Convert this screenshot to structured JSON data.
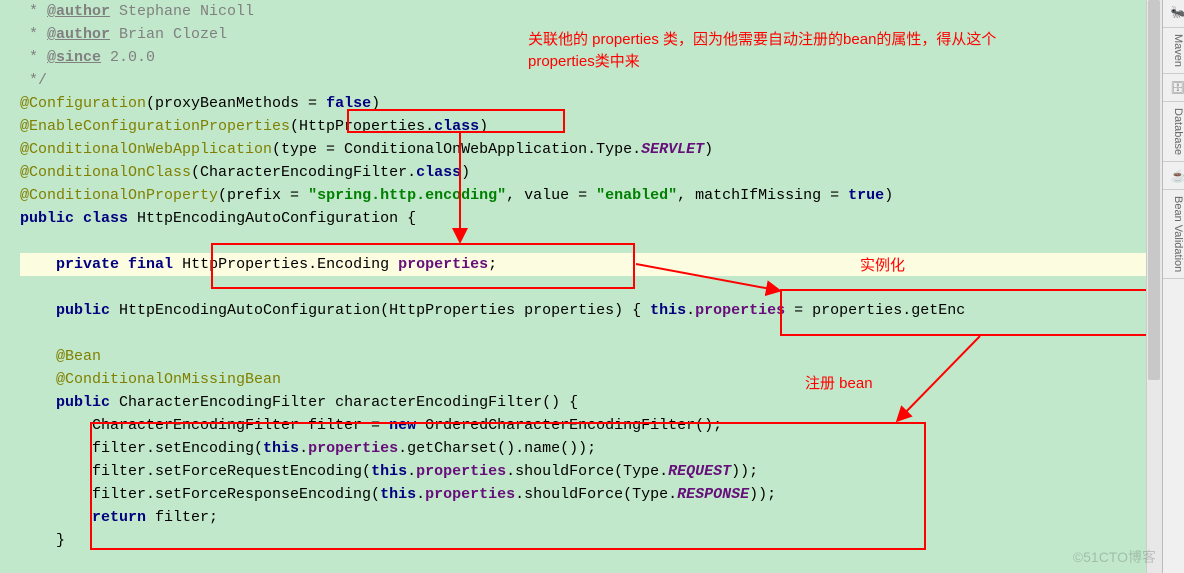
{
  "comments": {
    "l1a": " * ",
    "l1tag": "@author",
    "l1b": " Stephane Nicoll",
    "l2a": " * ",
    "l2tag": "@author",
    "l2b": " Brian Clozel",
    "l3a": " * ",
    "l3tag": "@since",
    "l3b": " 2.0.0",
    "l4": " */"
  },
  "code": {
    "cfg": "@Configuration",
    "cfgArg1": "(proxyBeanMethods = ",
    "false_": "false",
    "cfgArg2": ")",
    "ecp": "@EnableConfigurationProperties",
    "ecpArg1": "(HttpProperties.",
    "class_": "class",
    "ecpArg2": ")",
    "cowa": "@ConditionalOnWebApplication",
    "cowaArg1": "(type = ConditionalOnWebApplication.Type.",
    "servlet": "SERVLET",
    "cowaArg2": ")",
    "coc": "@ConditionalOnClass",
    "cocArg1": "(CharacterEncodingFilter.",
    "cocArg2": ")",
    "cop": "@ConditionalOnProperty",
    "copArg1": "(prefix = ",
    "copStr1": "\"spring.http.encoding\"",
    "copArg2": ", value = ",
    "copStr2": "\"enabled\"",
    "copArg3": ", matchIfMissing = ",
    "true_": "true",
    "copArg4": ")",
    "public": "public",
    "classKw": "class",
    "className": " HttpEncodingAutoConfiguration {",
    "private": "private",
    "final": "final",
    "propType": " HttpProperties.Encoding ",
    "propName": "properties",
    "semi": ";",
    "ctorA": " HttpEncodingAutoConfiguration(HttpProperties properties) { ",
    "this": "this",
    "dot": ".",
    "eq": " = properties.getEnc",
    "bean": "@Bean",
    "comb": "@ConditionalOnMissingBean",
    "mRet": " CharacterEncodingFilter characterEncodingFilter() {",
    "b1a": "CharacterEncodingFilter filter = ",
    "new": "new",
    "b1b": " OrderedCharacterEncodingFilter();",
    "b2a": "filter.setEncoding(",
    "b2b": ".getCharset().name());",
    "b3a": "filter.setForceRequestEncoding(",
    "b3b": ".shouldForce(Type.",
    "req": "REQUEST",
    "b3c": "));",
    "b4a": "filter.setForceResponseEncoding(",
    "b4b": ".shouldForce(Type.",
    "res": "RESPONSE",
    "b4c": "));",
    "return": "return",
    "retTail": " filter;",
    "brace": "}"
  },
  "annotations": {
    "top1": "关联他的 properties 类，因为他需要自动注册的bean的属性，得从这个",
    "top2": "properties类中来",
    "inst": "实例化",
    "reg": "注册 bean"
  },
  "sidebar": {
    "maven": "Maven",
    "db": "Database",
    "bean": "Bean Validation"
  },
  "watermark": "©51CTO博客"
}
